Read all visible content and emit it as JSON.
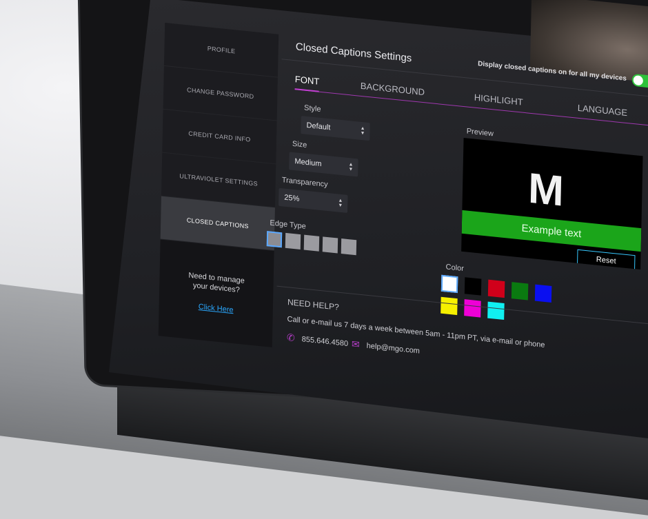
{
  "header": {
    "title": "Closed Captions Settings",
    "toggle_label": "Display closed captions on for all my devices",
    "toggle_state": "On"
  },
  "sidebar": {
    "items": [
      {
        "label": "PROFILE"
      },
      {
        "label": "CHANGE PASSWORD"
      },
      {
        "label": "CREDIT CARD INFO"
      },
      {
        "label": "ULTRAVIOLET SETTINGS"
      },
      {
        "label": "CLOSED CAPTIONS"
      }
    ],
    "help": {
      "line1": "Need to manage",
      "line2": "your devices?",
      "link": "Click Here"
    }
  },
  "tabs": [
    {
      "label": "FONT"
    },
    {
      "label": "BACKGROUND"
    },
    {
      "label": "HIGHLIGHT"
    },
    {
      "label": "LANGUAGE"
    }
  ],
  "font": {
    "style_label": "Style",
    "style_value": "Default",
    "size_label": "Size",
    "size_value": "Medium",
    "transparency_label": "Transparency",
    "transparency_value": "25%",
    "edge_label": "Edge Type"
  },
  "preview": {
    "label": "Preview",
    "logo": "M",
    "example_text": "Example text",
    "reset": "Reset"
  },
  "color": {
    "label": "Color",
    "swatches": [
      "#ffffff",
      "#000000",
      "#d0001a",
      "#0a7a10",
      "#0a0ff0",
      "#f6f000",
      "#ef00d6",
      "#10f0f0"
    ],
    "selected": "#ffffff"
  },
  "help": {
    "title": "NEED HELP?",
    "text": "Call or e-mail us 7 days a week between 5am - 11pm PT, via e-mail or phone",
    "phone": "855.646.4580",
    "email": "help@mgo.com"
  },
  "colors": {
    "accent": "#c13fd1",
    "toggle_on": "#2ec23a",
    "caption_bg": "#1ba51a",
    "link": "#2aa8ff"
  }
}
